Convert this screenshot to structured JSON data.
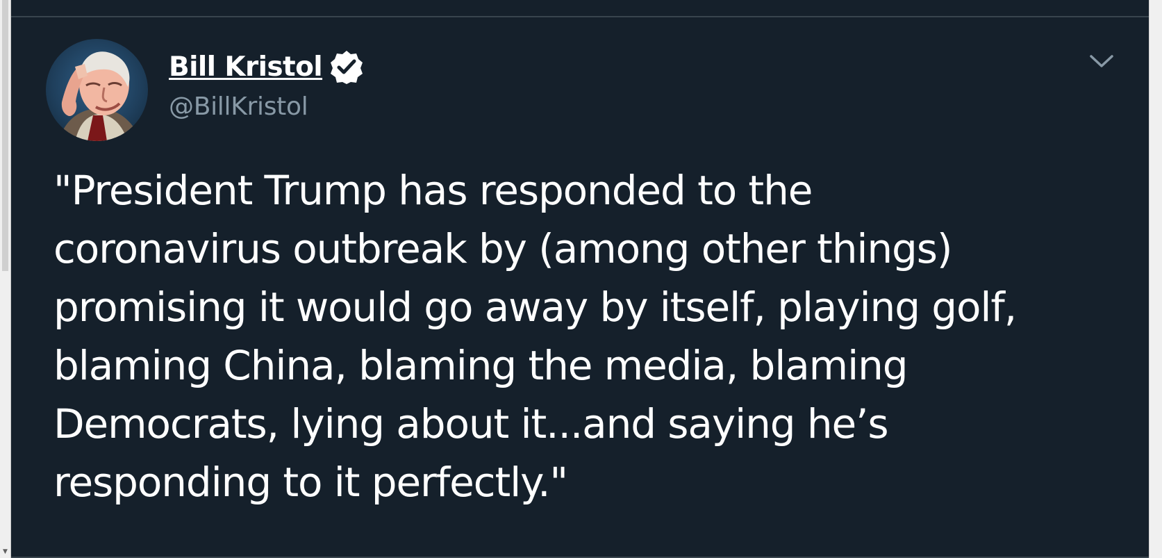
{
  "tweet": {
    "author": {
      "display_name": "Bill Kristol",
      "handle": "@BillKristol"
    },
    "text": "\"President Trump has responded to the\ncoronavirus outbreak by (among other things)\npromising it would go away by itself, playing golf,\nblaming China, blaming the media, blaming\nDemocrats, lying about it...and saying he’s\nresponding to it perfectly.\""
  },
  "icons": {
    "verified": "verified-icon",
    "menu": "chevron-down-icon",
    "avatar": "profile-photo"
  },
  "colors": {
    "background": "#15202b",
    "text": "#ffffff",
    "secondary_text": "#8899a6",
    "divider": "#38444d",
    "scrollbar": "#f0f0f0"
  }
}
